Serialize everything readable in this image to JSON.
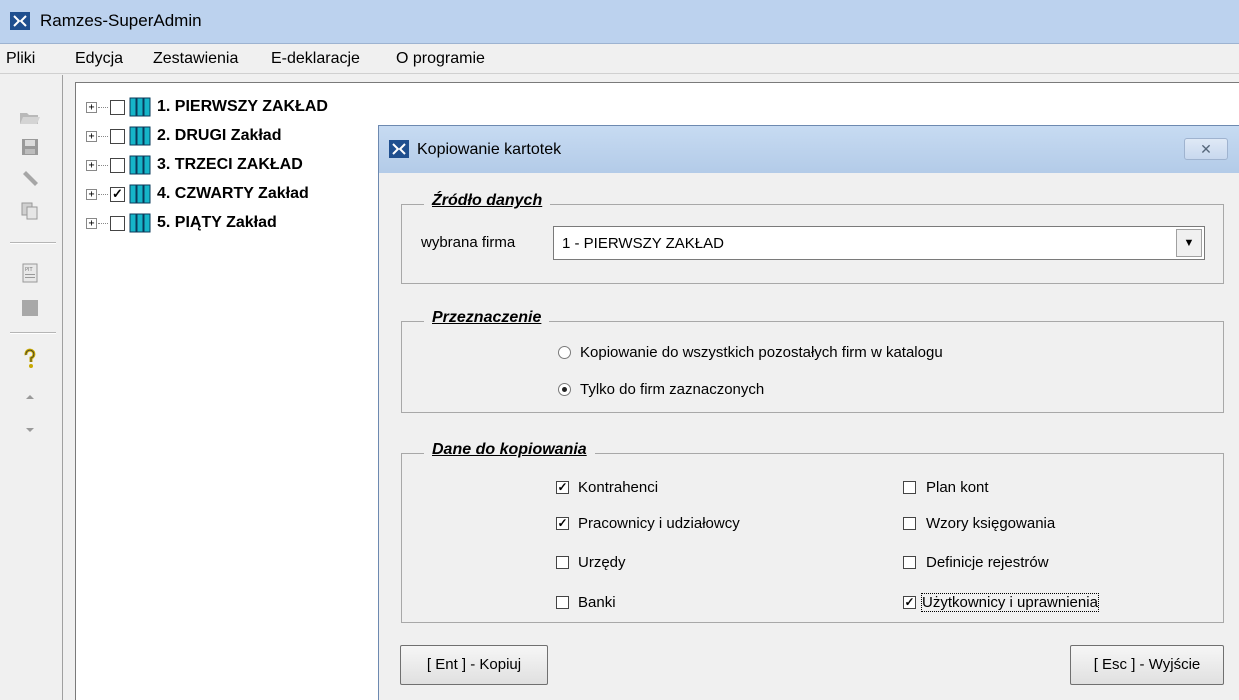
{
  "window": {
    "title": "Ramzes-SuperAdmin"
  },
  "menu": [
    "Pliki",
    "Edycja",
    "Zestawienia",
    "E-deklaracje",
    "O programie"
  ],
  "tree": [
    {
      "label": "1. PIERWSZY ZAKŁAD",
      "checked": false
    },
    {
      "label": "2. DRUGI Zakład",
      "checked": false
    },
    {
      "label": "3. TRZECI ZAKŁAD",
      "checked": false
    },
    {
      "label": "4. CZWARTY Zakład",
      "checked": true
    },
    {
      "label": "5. PIĄTY Zakład",
      "checked": false
    }
  ],
  "dialog": {
    "title": "Kopiowanie kartotek",
    "close": "✕",
    "source": {
      "title": "Źródło danych",
      "label": "wybrana firma",
      "value": "1 -  PIERWSZY ZAKŁAD"
    },
    "destination": {
      "title": "Przeznaczenie",
      "options": [
        {
          "label": "Kopiowanie do wszystkich pozostałych firm w katalogu",
          "selected": false
        },
        {
          "label": "Tylko do firm zaznaczonych",
          "selected": true
        }
      ]
    },
    "data": {
      "title": "Dane do kopiowania",
      "items": [
        {
          "label": "Kontrahenci",
          "checked": true
        },
        {
          "label": "Pracownicy i udziałowcy",
          "checked": true
        },
        {
          "label": "Urzędy",
          "checked": false
        },
        {
          "label": "Banki",
          "checked": false
        },
        {
          "label": "Plan kont",
          "checked": false
        },
        {
          "label": "Wzory księgowania",
          "checked": false
        },
        {
          "label": "Definicje rejestrów",
          "checked": false
        },
        {
          "label": "Użytkownicy i uprawnienia",
          "checked": true
        }
      ]
    },
    "buttons": {
      "copy": "[ Ent ] - Kopiuj",
      "exit": "[ Esc ] - Wyjście"
    }
  },
  "check_mark": "✓",
  "combo_arrow": "▼",
  "tree_expander": "+"
}
